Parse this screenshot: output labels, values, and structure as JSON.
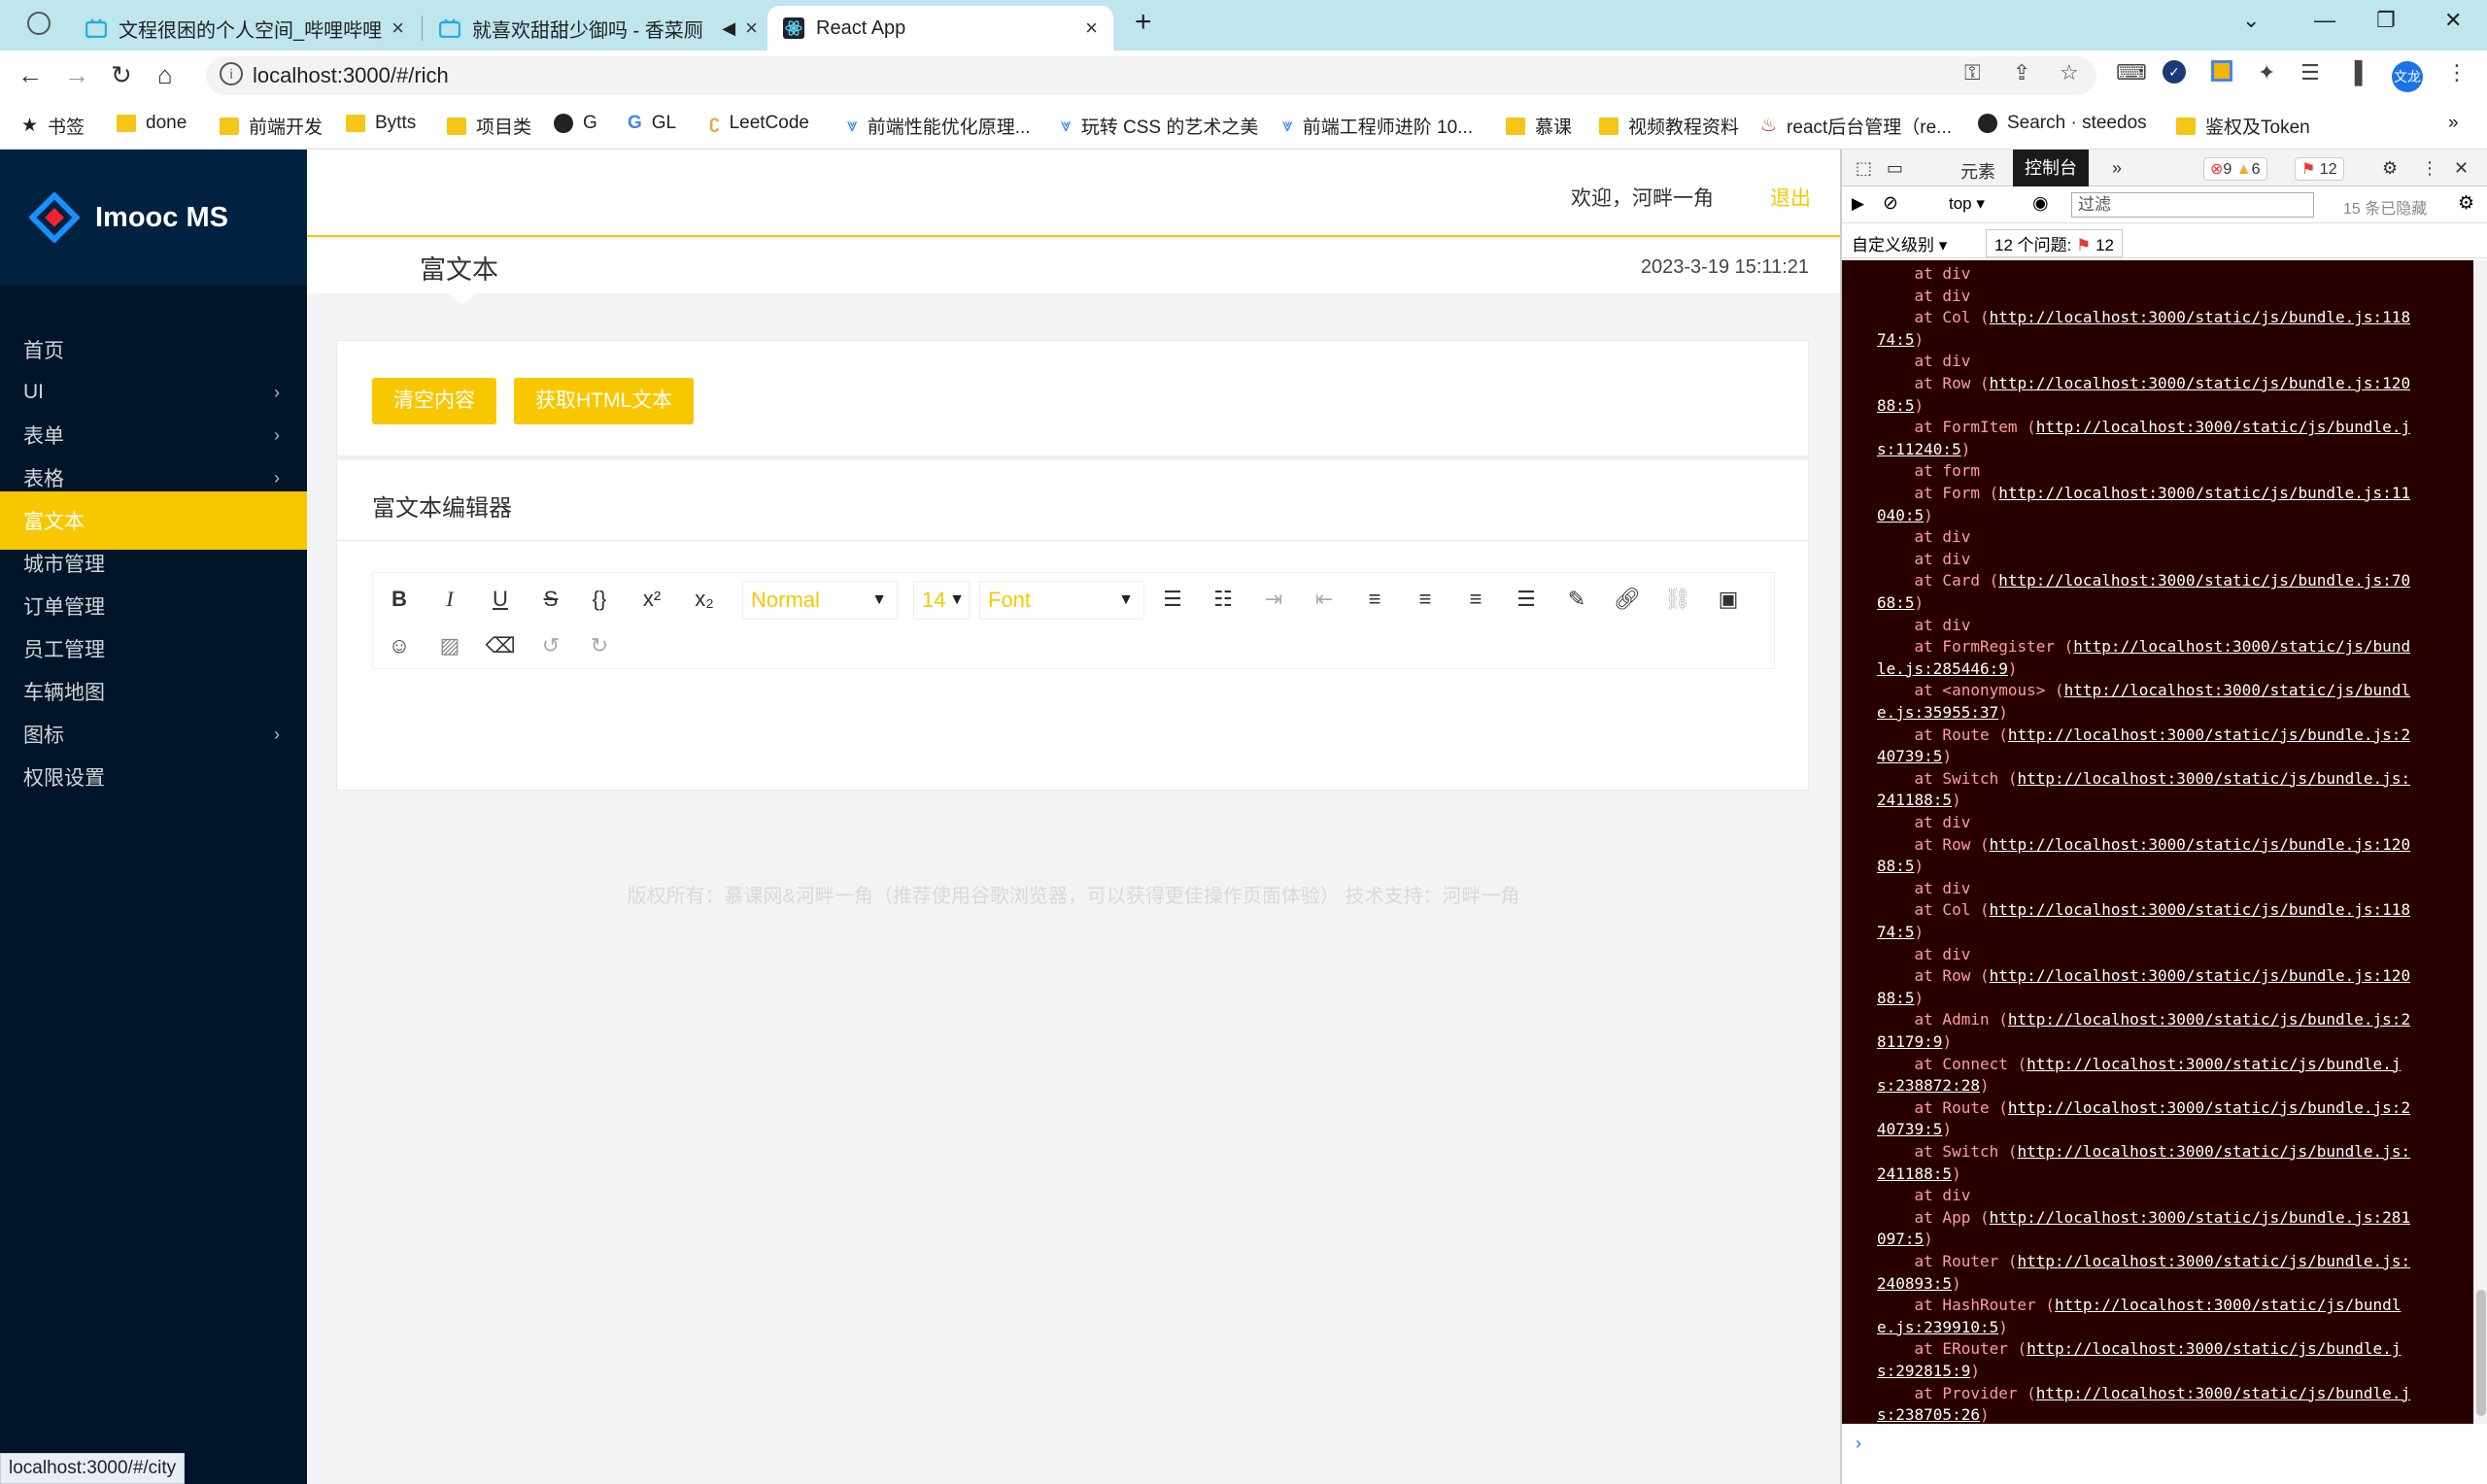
{
  "browser": {
    "tabs": [
      {
        "title": "文程很困的个人空间_哔哩哔哩_b",
        "active": false
      },
      {
        "title": "就喜欢甜甜少御吗 - 香菜厕",
        "active": false
      },
      {
        "title": "React App",
        "active": true
      }
    ],
    "url": "localhost:3000/#/rich",
    "profile_initials": "文龙",
    "bookmarks": [
      "书签",
      "done",
      "前端开发",
      "Bytts",
      "项目类",
      "G",
      "GL",
      "LeetCode",
      "前端性能优化原理...",
      "玩转 CSS 的艺术之美",
      "前端工程师进阶 10...",
      "慕课",
      "视频教程资料",
      "react后台管理（re...",
      "Search · steedos",
      "鉴权及Token"
    ],
    "status_url": "localhost:3000/#/city"
  },
  "app": {
    "brand": "Imooc MS",
    "menu": [
      {
        "label": "首页",
        "has_children": false,
        "active": false
      },
      {
        "label": "UI",
        "has_children": true,
        "active": false
      },
      {
        "label": "表单",
        "has_children": true,
        "active": false
      },
      {
        "label": "表格",
        "has_children": true,
        "active": false
      },
      {
        "label": "富文本",
        "has_children": false,
        "active": true
      },
      {
        "label": "城市管理",
        "has_children": false,
        "active": false
      },
      {
        "label": "订单管理",
        "has_children": false,
        "active": false
      },
      {
        "label": "员工管理",
        "has_children": false,
        "active": false
      },
      {
        "label": "车辆地图",
        "has_children": false,
        "active": false
      },
      {
        "label": "图标",
        "has_children": true,
        "active": false
      },
      {
        "label": "权限设置",
        "has_children": false,
        "active": false
      }
    ],
    "header": {
      "welcome": "欢迎，河畔一角",
      "logout": "退出",
      "page_title": "富文本",
      "datetime": "2023-3-19 15:11:21"
    },
    "actions": {
      "clear": "清空内容",
      "get_html": "获取HTML文本"
    },
    "editor_card_title": "富文本编辑器",
    "editor": {
      "block_type": "Normal",
      "font_size": "14",
      "font_family": "Font"
    },
    "footer": "版权所有：慕课网&河畔一角（推荐使用谷歌浏览器，可以获得更佳操作页面体验） 技术支持：河畔一角",
    "accent_color": "#f9c700"
  },
  "devtools": {
    "tabs": [
      "元素",
      "控制台"
    ],
    "active_tab": "控制台",
    "error_count": "9",
    "warning_count": "6",
    "issue_badge": "12",
    "context": "top",
    "filter_placeholder": "过滤",
    "hidden_count": "15 条已隐藏",
    "level_label": "自定义级别",
    "issues_label": "12 个问题:",
    "issues_count": "12",
    "console_lines": [
      "    at div",
      "    at div",
      "    at Col (http://localhost:3000/static/js/bundle.js:118",
      "74:5)",
      "    at div",
      "    at Row (http://localhost:3000/static/js/bundle.js:120",
      "88:5)",
      "    at FormItem (http://localhost:3000/static/js/bundle.j",
      "s:11240:5)",
      "    at form",
      "    at Form (http://localhost:3000/static/js/bundle.js:11",
      "040:5)",
      "    at div",
      "    at div",
      "    at Card (http://localhost:3000/static/js/bundle.js:70",
      "68:5)",
      "    at div",
      "    at FormRegister (http://localhost:3000/static/js/bund",
      "le.js:285446:9)",
      "    at <anonymous> (http://localhost:3000/static/js/bundl",
      "e.js:35955:37)",
      "    at Route (http://localhost:3000/static/js/bundle.js:2",
      "40739:5)",
      "    at Switch (http://localhost:3000/static/js/bundle.js:",
      "241188:5)",
      "    at div",
      "    at Row (http://localhost:3000/static/js/bundle.js:120",
      "88:5)",
      "    at div",
      "    at Col (http://localhost:3000/static/js/bundle.js:118",
      "74:5)",
      "    at div",
      "    at Row (http://localhost:3000/static/js/bundle.js:120",
      "88:5)",
      "    at Admin (http://localhost:3000/static/js/bundle.js:2",
      "81179:9)",
      "    at Connect (http://localhost:3000/static/js/bundle.j",
      "s:238872:28)",
      "    at Route (http://localhost:3000/static/js/bundle.js:2",
      "40739:5)",
      "    at Switch (http://localhost:3000/static/js/bundle.js:",
      "241188:5)",
      "    at div",
      "    at App (http://localhost:3000/static/js/bundle.js:281",
      "097:5)",
      "    at Router (http://localhost:3000/static/js/bundle.js:",
      "240893:5)",
      "    at HashRouter (http://localhost:3000/static/js/bundl",
      "e.js:239910:5)",
      "    at ERouter (http://localhost:3000/static/js/bundle.j",
      "s:292815:9)",
      "    at Provider (http://localhost:3000/static/js/bundle.j",
      "s:238705:26)"
    ]
  }
}
